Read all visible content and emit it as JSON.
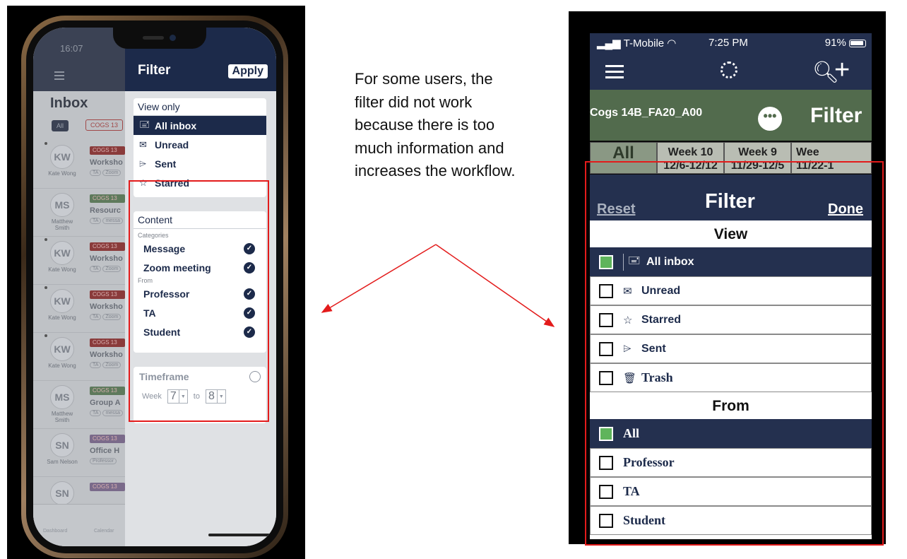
{
  "left_phone": {
    "status_time": "16:07",
    "inbox": {
      "title": "Inbox",
      "chip_all": "All",
      "chip_course": "COGS 13",
      "rows": [
        {
          "initials": "KW",
          "name": "Kate Wong",
          "tag": "COGS 13",
          "subject": "Worksho",
          "pills": [
            "TA",
            "Zoom"
          ],
          "tag_color": "#8a3b3b"
        },
        {
          "initials": "MS",
          "name": "Matthew Smith",
          "tag": "COGS 13",
          "subject": "Resourc",
          "pills": [
            "TA",
            "messa"
          ],
          "tag_color": "#5e7a5c"
        },
        {
          "initials": "KW",
          "name": "Kate Wong",
          "tag": "COGS 13",
          "subject": "Worksho",
          "pills": [
            "TA",
            "Zoom"
          ],
          "tag_color": "#8a3b3b"
        },
        {
          "initials": "KW",
          "name": "Kate Wong",
          "tag": "COGS 13",
          "subject": "Worksho",
          "pills": [
            "TA",
            "Zoom"
          ],
          "tag_color": "#8a3b3b"
        },
        {
          "initials": "KW",
          "name": "Kate Wong",
          "tag": "COGS 13",
          "subject": "Worksho",
          "pills": [
            "TA",
            "Zoom"
          ],
          "tag_color": "#8a3b3b"
        },
        {
          "initials": "MS",
          "name": "Matthew Smith",
          "tag": "COGS 13",
          "subject": "Group A",
          "pills": [
            "TA",
            "messa"
          ],
          "tag_color": "#5e7a5c"
        },
        {
          "initials": "SN",
          "name": "Sam Nelson",
          "tag": "COGS 13",
          "subject": "Office H",
          "pills": [
            "Professor"
          ],
          "tag_color": "#7a6a8a"
        },
        {
          "initials": "SN",
          "name": "",
          "tag": "COGS 13",
          "subject": "",
          "pills": [],
          "tag_color": "#7a6a8a"
        }
      ],
      "tabs": [
        "Dashboard",
        "Calendar"
      ]
    },
    "filter": {
      "title": "Filter",
      "apply_label": "Apply",
      "view_only_header": "View only",
      "view_items": [
        {
          "icon": "🖃",
          "label": "All inbox",
          "selected": true
        },
        {
          "icon": "✉",
          "label": "Unread",
          "selected": false
        },
        {
          "icon": "⌲",
          "label": "Sent",
          "selected": false
        },
        {
          "icon": "☆",
          "label": "Starred",
          "selected": false
        }
      ],
      "content_header": "Content",
      "categories_caption": "Categories",
      "categories": [
        "Message",
        "Zoom meeting"
      ],
      "from_caption": "From",
      "from_items": [
        "Professor",
        "TA",
        "Student"
      ],
      "timeframe_label": "Timeframe",
      "week_label": "Week",
      "week_from": "7",
      "to_label": "to",
      "week_to": "8"
    }
  },
  "caption": "For some users, the filter did not work because there is too much information and increases the workflow.",
  "right_phone": {
    "status": {
      "carrier": "T-Mobile",
      "time": "7:25 PM",
      "battery": "91%"
    },
    "course": "Cogs 14B_FA20_A00",
    "more_label": "•••",
    "header_title": "Filter",
    "weeks": [
      {
        "label": "All",
        "dates": ""
      },
      {
        "label": "Week 10",
        "dates": "12/6-12/12"
      },
      {
        "label": "Week 9",
        "dates": "11/29-12/5"
      },
      {
        "label": "Wee",
        "dates": "11/22-1"
      }
    ],
    "modal": {
      "reset_label": "Reset",
      "title": "Filter",
      "done_label": "Done",
      "view_header": "View",
      "view_items": [
        {
          "icon": "🖃",
          "label": "All inbox",
          "selected": true
        },
        {
          "icon": "✉",
          "label": "Unread",
          "selected": false
        },
        {
          "icon": "☆",
          "label": "Starred",
          "selected": false
        },
        {
          "icon": "⌲",
          "label": "Sent",
          "selected": false
        },
        {
          "icon": "🗑",
          "label": "Trash",
          "selected": false
        }
      ],
      "from_header": "From",
      "from_items": [
        {
          "label": "All",
          "selected": true
        },
        {
          "label": "Professor",
          "selected": false
        },
        {
          "label": "TA",
          "selected": false
        },
        {
          "label": "Student",
          "selected": false
        }
      ]
    }
  },
  "colors": {
    "highlight": "#e31b1b",
    "navy": "#1c2a4a",
    "green_check": "#5fb45c"
  }
}
